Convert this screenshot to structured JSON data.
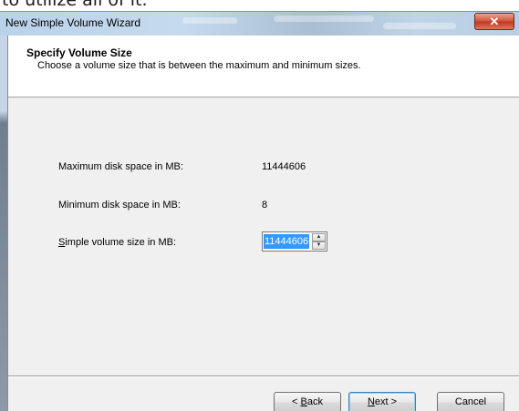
{
  "background_text": "to utilize all of it.",
  "window": {
    "title": "New Simple Volume Wizard",
    "close_glyph": "✕"
  },
  "header": {
    "title": "Specify Volume Size",
    "subtitle": "Choose a volume size that is between the maximum and minimum sizes."
  },
  "fields": {
    "max_label": "Maximum disk space in MB:",
    "max_value": "11444606",
    "min_label": "Minimum disk space in MB:",
    "min_value": "8",
    "size_label_mnemonic": "S",
    "size_label_rest": "imple volume size in MB:",
    "size_value": "11444606"
  },
  "spinner": {
    "up_icon": "▲",
    "down_icon": "▼"
  },
  "buttons": {
    "back_prefix": "< ",
    "back_mnemonic": "B",
    "back_rest": "ack",
    "next_mnemonic": "N",
    "next_rest": "ext >",
    "cancel_label": "Cancel"
  },
  "colors": {
    "selection": "#3399ff",
    "close_button": "#c33a22",
    "default_button_border": "#3c7fb1"
  }
}
